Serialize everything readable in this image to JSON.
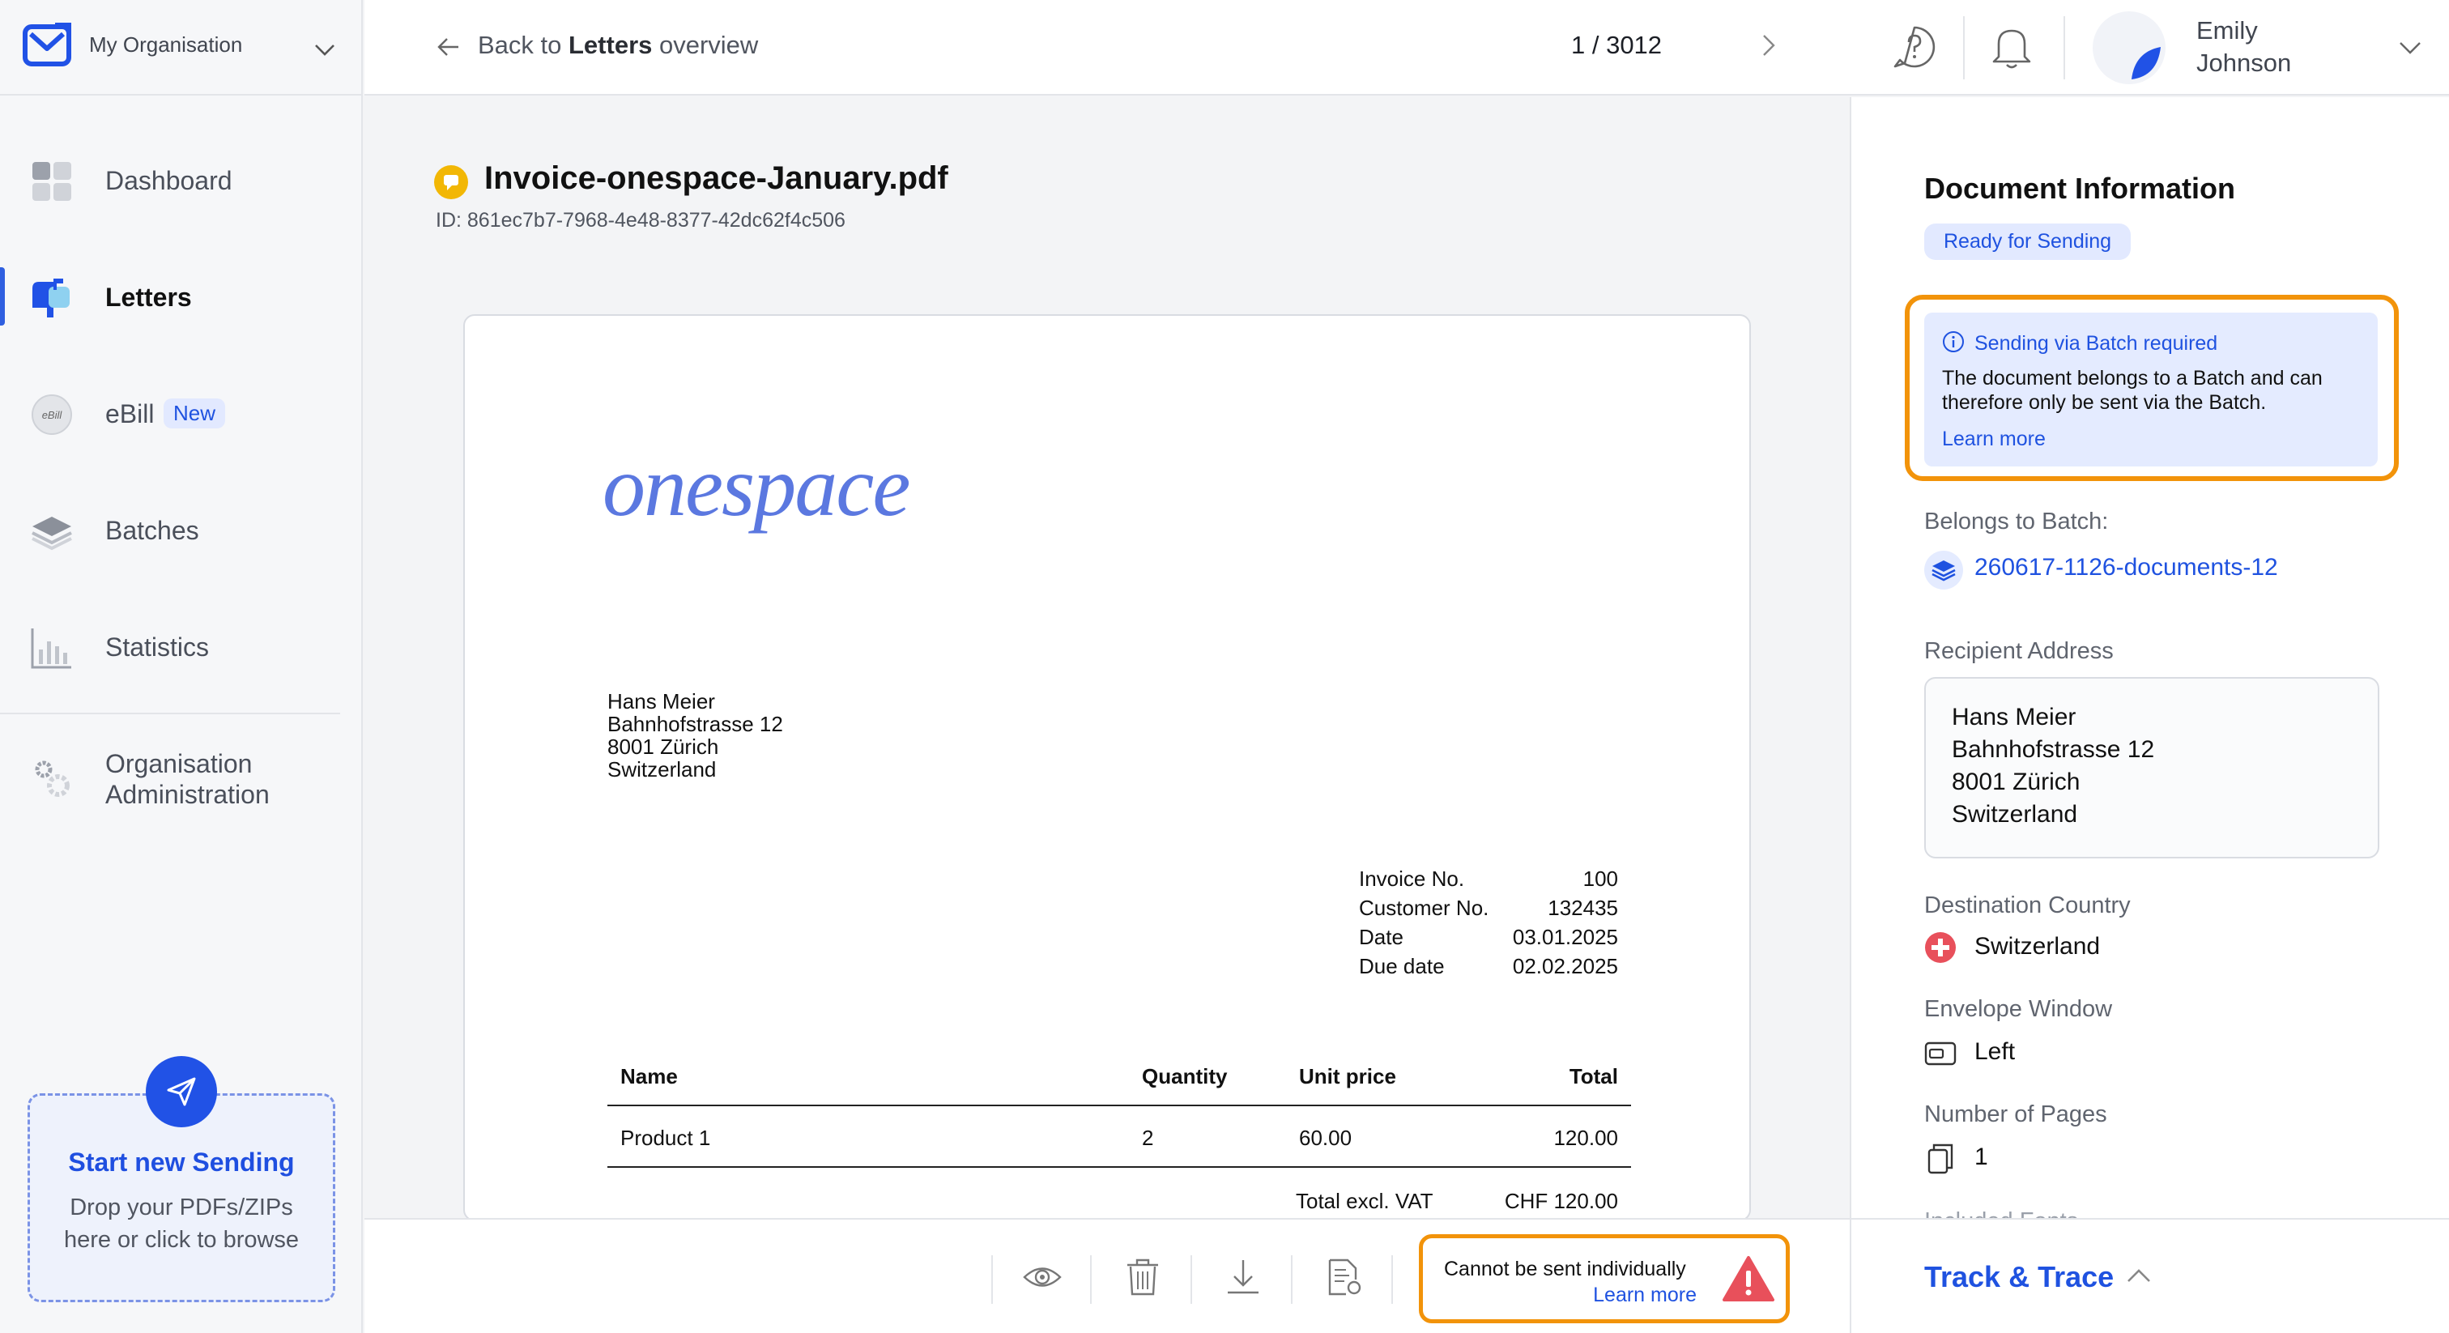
{
  "org": {
    "name": "My Organisation"
  },
  "sidebar": {
    "items": [
      {
        "label": "Dashboard",
        "icon": "dashboard-icon"
      },
      {
        "label": "Letters",
        "icon": "letters-mailbox-icon",
        "active": true
      },
      {
        "label": "eBill",
        "icon": "ebill-icon",
        "badge": "New",
        "icon_text": "eBill"
      },
      {
        "label": "Batches",
        "icon": "layers-icon"
      },
      {
        "label": "Statistics",
        "icon": "bar-chart-icon"
      }
    ],
    "admin_label_1": "Organisation",
    "admin_label_2": "Administration"
  },
  "dropzone": {
    "title": "Start new Sending",
    "sub1": "Drop your PDFs/ZIPs",
    "sub2": "here or click to browse"
  },
  "header": {
    "back_prefix": "Back to ",
    "back_bold": "Letters",
    "back_suffix": " overview",
    "pager": "1 / 3012",
    "user_first": "Emily",
    "user_last": "Johnson"
  },
  "document": {
    "title": "Invoice-onespace-January.pdf",
    "id": "ID: 861ec7b7-7968-4e48-8377-42dc62f4c506",
    "logo_text": "onespace",
    "address": [
      "Hans Meier",
      "Bahnhofstrasse 12",
      "8001 Zürich",
      "Switzerland"
    ],
    "meta": [
      {
        "k": "Invoice No.",
        "v": "100"
      },
      {
        "k": "Customer No.",
        "v": "132435"
      },
      {
        "k": "Date",
        "v": "03.01.2025"
      },
      {
        "k": "Due date",
        "v": "02.02.2025"
      }
    ],
    "table": {
      "headers": [
        "Name",
        "Quantity",
        "Unit price",
        "Total"
      ],
      "rows": [
        [
          "Product 1",
          "2",
          "60.00",
          "120.00"
        ]
      ]
    },
    "total_label": "Total excl. VAT",
    "total_value": "CHF 120.00"
  },
  "actionbar": {
    "warning": "Cannot be sent individually",
    "warning_link": "Learn more"
  },
  "panel": {
    "title": "Document Information",
    "status": "Ready for Sending",
    "info_head": "Sending via Batch required",
    "info_body": "The document belongs to a Batch and can therefore only be sent via the Batch.",
    "info_link": "Learn more",
    "batch_label": "Belongs to Batch:",
    "batch_link": "260617-1126-documents-12",
    "recipient_label": "Recipient Address",
    "recipient": [
      "Hans Meier",
      "Bahnhofstrasse 12",
      "8001 Zürich",
      "Switzerland"
    ],
    "country_label": "Destination Country",
    "country": "Switzerland",
    "window_label": "Envelope Window",
    "window": "Left",
    "pages_label": "Number of Pages",
    "pages": "1",
    "fonts_label": "Included Fonts",
    "track_label": "Track & Trace"
  },
  "colors": {
    "accent": "#2152e6",
    "warning": "#f2930a",
    "danger": "#e8505b"
  }
}
